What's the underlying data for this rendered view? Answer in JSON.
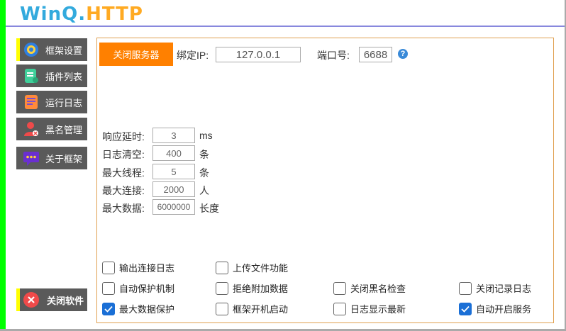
{
  "app": {
    "logo_part1": "WinQ.",
    "logo_part2": "HTTP"
  },
  "sidebar": {
    "items": [
      {
        "label": "框架设置",
        "icon": "gear-icon",
        "active": true
      },
      {
        "label": "插件列表",
        "icon": "document-icon",
        "active": false
      },
      {
        "label": "运行日志",
        "icon": "log-icon",
        "active": false
      },
      {
        "label": "黑名管理",
        "icon": "user-block-icon",
        "active": false
      },
      {
        "label": "关于框架",
        "icon": "chat-icon",
        "active": false
      }
    ],
    "exit_label": "关闭软件"
  },
  "server": {
    "stop_button": "关闭服务器",
    "bind_ip_label": "绑定IP:",
    "bind_ip_value": "127.0.0.1",
    "port_label": "端口号:",
    "port_value": "6688",
    "help": "?"
  },
  "settings": [
    {
      "label": "响应延时:",
      "value": "3",
      "unit": "ms"
    },
    {
      "label": "日志清空:",
      "value": "400",
      "unit": "条"
    },
    {
      "label": "最大线程:",
      "value": "5",
      "unit": "条"
    },
    {
      "label": "最大连接:",
      "value": "2000",
      "unit": "人"
    },
    {
      "label": "最大数据:",
      "value": "6000000",
      "unit": "长度"
    }
  ],
  "options": [
    {
      "label": "输出连接日志",
      "checked": false
    },
    {
      "label": "上传文件功能",
      "checked": false
    },
    {
      "label": "自动保护机制",
      "checked": false
    },
    {
      "label": "拒绝附加数据",
      "checked": false
    },
    {
      "label": "关闭黑名检查",
      "checked": false
    },
    {
      "label": "关闭记录日志",
      "checked": false
    },
    {
      "label": "最大数据保护",
      "checked": true
    },
    {
      "label": "框架开机启动",
      "checked": false
    },
    {
      "label": "日志显示最新",
      "checked": false
    },
    {
      "label": "自动开启服务",
      "checked": true
    }
  ],
  "colors": {
    "accent_orange": "#ff8000",
    "side_bg": "#5a5a5a",
    "check_blue": "#1a6fd6",
    "frame_green": "#00ff00"
  }
}
